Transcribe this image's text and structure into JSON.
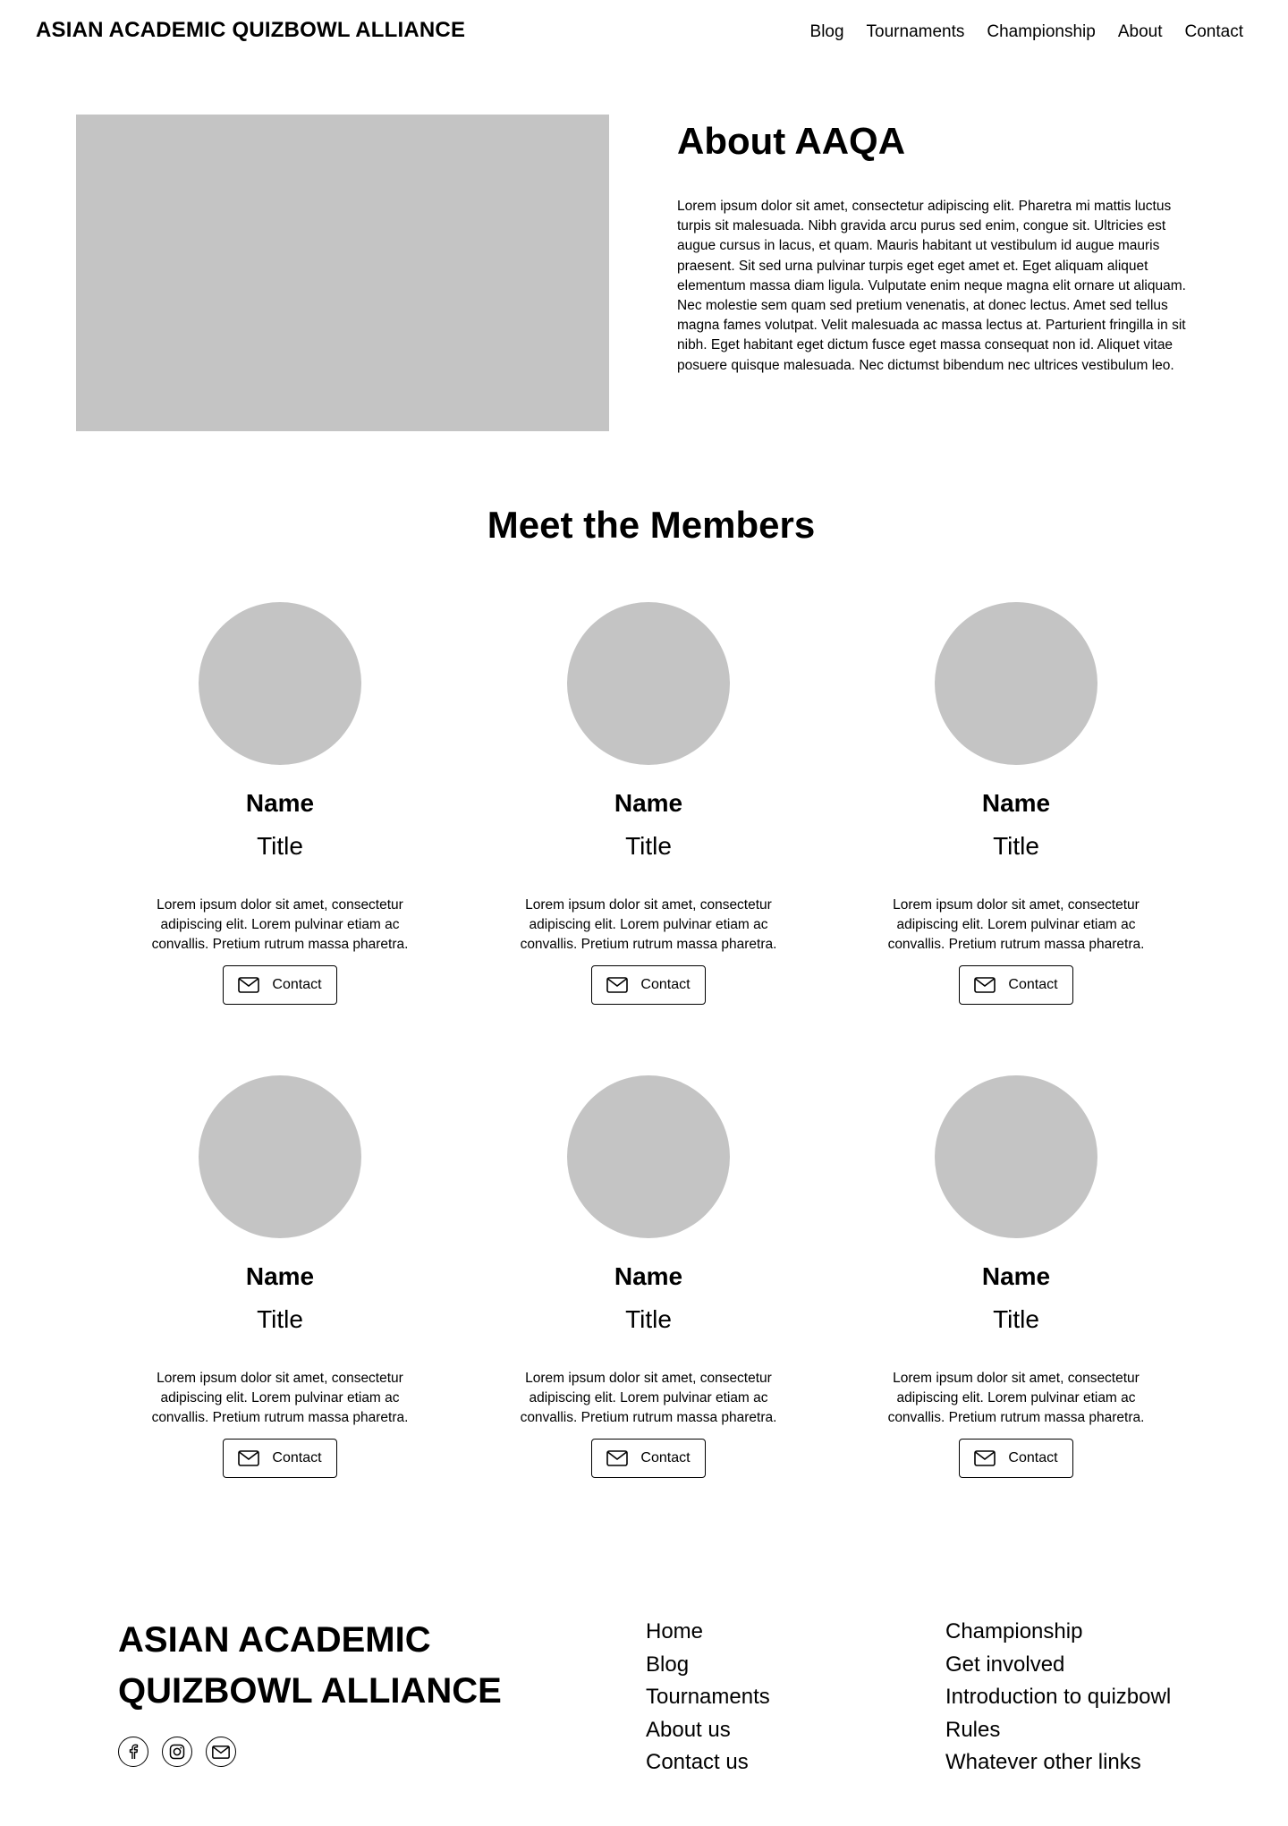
{
  "header": {
    "site_title": "ASIAN ACADEMIC QUIZBOWL ALLIANCE",
    "nav": [
      "Blog",
      "Tournaments",
      "Championship",
      "About",
      "Contact"
    ]
  },
  "about": {
    "heading": "About AAQA",
    "body": "Lorem ipsum dolor sit amet, consectetur adipiscing elit. Pharetra mi mattis luctus turpis sit malesuada. Nibh gravida arcu purus sed enim, congue sit. Ultricies est augue cursus in lacus, et quam. Mauris habitant ut vestibulum id augue mauris praesent. Sit sed urna pulvinar turpis eget eget amet et. Eget aliquam aliquet elementum massa diam ligula. Vulputate enim neque magna elit ornare ut aliquam. Nec molestie sem quam sed pretium venenatis, at donec lectus. Amet sed tellus magna fames volutpat. Velit malesuada ac massa lectus at. Parturient fringilla in sit nibh. Eget habitant eget dictum fusce eget massa consequat non id. Aliquet vitae posuere quisque malesuada. Nec dictumst bibendum nec ultrices vestibulum leo."
  },
  "members": {
    "heading": "Meet the Members",
    "list": [
      {
        "name": "Name",
        "title": "Title",
        "description": "Lorem ipsum dolor sit amet, consectetur adipiscing elit. Lorem pulvinar etiam ac convallis. Pretium rutrum massa pharetra.",
        "contact_label": "Contact"
      },
      {
        "name": "Name",
        "title": "Title",
        "description": "Lorem ipsum dolor sit amet, consectetur adipiscing elit. Lorem pulvinar etiam ac convallis. Pretium rutrum massa pharetra.",
        "contact_label": "Contact"
      },
      {
        "name": "Name",
        "title": "Title",
        "description": "Lorem ipsum dolor sit amet, consectetur adipiscing elit. Lorem pulvinar etiam ac convallis. Pretium rutrum massa pharetra.",
        "contact_label": "Contact"
      },
      {
        "name": "Name",
        "title": "Title",
        "description": "Lorem ipsum dolor sit amet, consectetur adipiscing elit. Lorem pulvinar etiam ac convallis. Pretium rutrum massa pharetra.",
        "contact_label": "Contact"
      },
      {
        "name": "Name",
        "title": "Title",
        "description": "Lorem ipsum dolor sit amet, consectetur adipiscing elit. Lorem pulvinar etiam ac convallis. Pretium rutrum massa pharetra.",
        "contact_label": "Contact"
      },
      {
        "name": "Name",
        "title": "Title",
        "description": "Lorem ipsum dolor sit amet, consectetur adipiscing elit. Lorem pulvinar etiam ac convallis. Pretium rutrum massa pharetra.",
        "contact_label": "Contact"
      }
    ]
  },
  "footer": {
    "title_line1": "ASIAN ACADEMIC",
    "title_line2": "QUIZBOWL ALLIANCE",
    "socials": [
      "facebook-icon",
      "instagram-icon",
      "mail-icon"
    ],
    "links_col1": [
      "Home",
      "Blog",
      "Tournaments",
      "About us",
      "Contact us"
    ],
    "links_col2": [
      "Championship",
      "Get involved",
      "Introduction to quizbowl",
      "Rules",
      "Whatever other links"
    ]
  }
}
